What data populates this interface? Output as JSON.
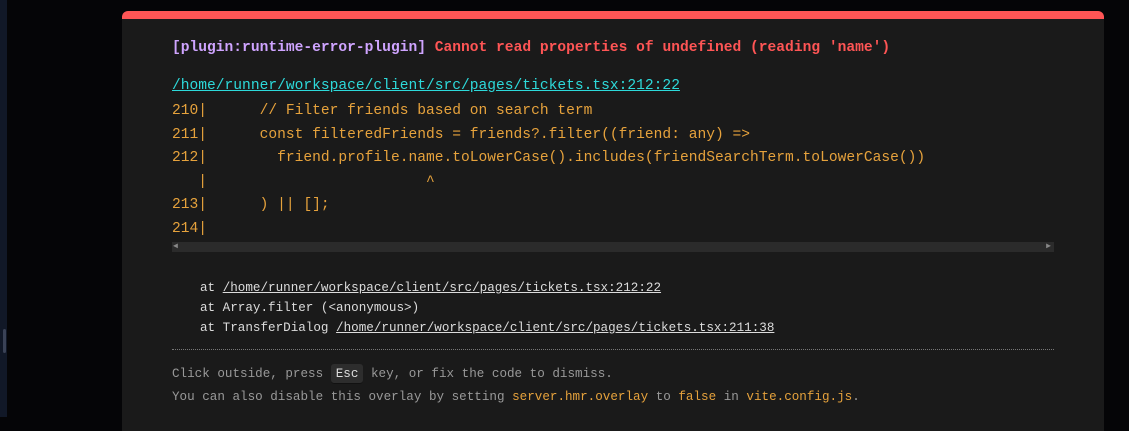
{
  "error": {
    "plugin": "[plugin:runtime-error-plugin]",
    "message": "Cannot read properties of undefined (reading 'name')",
    "file": "/home/runner/workspace/client/src/pages/tickets.tsx:212:22",
    "frame": [
      "210|      // Filter friends based on search term",
      "211|      const filteredFriends = friends?.filter((friend: any) =>",
      "212|        friend.profile.name.toLowerCase().includes(friendSearchTerm.toLowerCase())",
      "   |                         ^",
      "213|      ) || [];",
      "214|"
    ],
    "stack": [
      {
        "prefix": "at ",
        "link": "/home/runner/workspace/client/src/pages/tickets.tsx:212:22"
      },
      {
        "prefix": "at Array.filter (<anonymous>)",
        "link": ""
      },
      {
        "prefix": "at TransferDialog ",
        "link": "/home/runner/workspace/client/src/pages/tickets.tsx:211:38"
      }
    ]
  },
  "tip": {
    "line1_a": "Click outside, press ",
    "key": "Esc",
    "line1_b": " key, or fix the code to dismiss.",
    "line2_a": "You can also disable this overlay by setting ",
    "setting": "server.hmr.overlay",
    "line2_b": " to ",
    "value": "false",
    "line2_c": " in ",
    "config": "vite.config.js",
    "line2_d": "."
  },
  "colors": {
    "accent": "#ff5555",
    "plugin": "#cfa4ff",
    "file": "#2dd9da",
    "code": "#e6a23c"
  }
}
